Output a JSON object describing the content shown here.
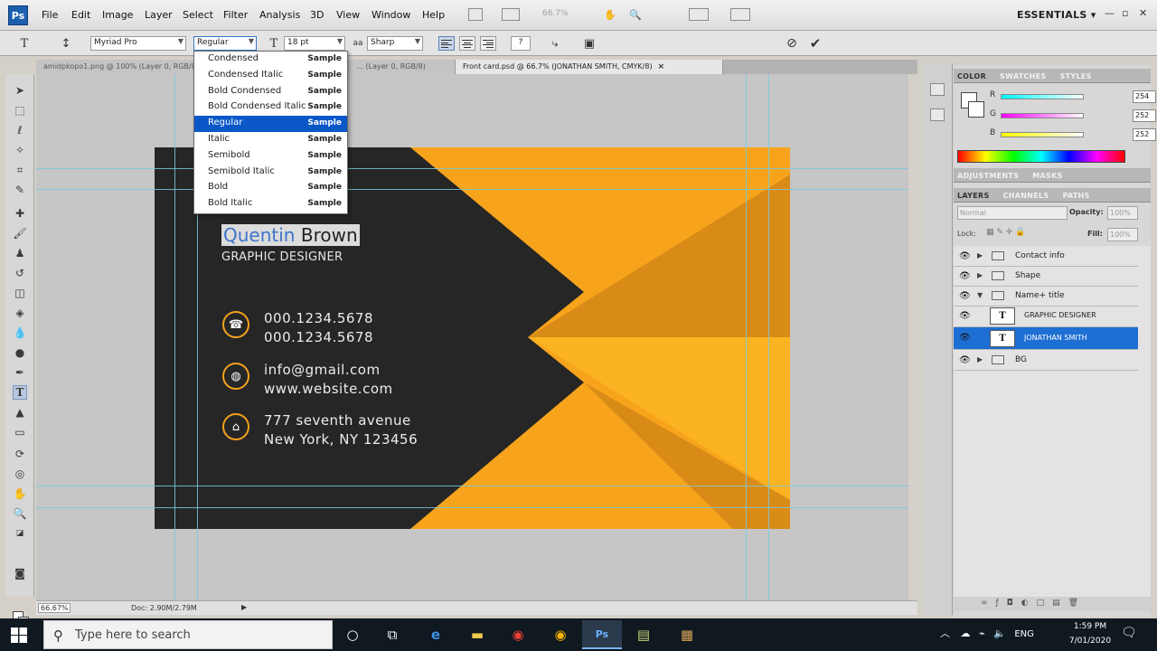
{
  "app": {
    "logo": "Ps",
    "workspace": "ESSENTIALS ▾"
  },
  "menu": [
    "File",
    "Edit",
    "Image",
    "Layer",
    "Select",
    "Filter",
    "Analysis",
    "3D",
    "View",
    "Window",
    "Help"
  ],
  "menubar_dim": "66.7%",
  "options": {
    "font_family": "Myriad Pro",
    "font_style": "Regular",
    "font_size": "18 pt",
    "antialias_label": "aa",
    "antialias": "Sharp"
  },
  "tabs": [
    {
      "label": "amidpkopo1.png @ 100% (Layer 0, RGB/8)",
      "active": false
    },
    {
      "label": "… (Layer 0, RGB/8)",
      "active": false
    },
    {
      "label": "Front card.psd @ 66.7% (JONATHAN SMITH, CMYK/8)",
      "active": true,
      "close": "×"
    }
  ],
  "font_styles": [
    {
      "name": "Condensed",
      "sample": "Sample"
    },
    {
      "name": "Condensed Italic",
      "sample": "Sample"
    },
    {
      "name": "Bold Condensed",
      "sample": "Sample"
    },
    {
      "name": "Bold Condensed Italic",
      "sample": "Sample"
    },
    {
      "name": "Regular",
      "sample": "Sample",
      "selected": true
    },
    {
      "name": "Italic",
      "sample": "Sample"
    },
    {
      "name": "Semibold",
      "sample": "Sample"
    },
    {
      "name": "Semibold Italic",
      "sample": "Sample"
    },
    {
      "name": "Bold",
      "sample": "Sample"
    },
    {
      "name": "Bold Italic",
      "sample": "Sample"
    }
  ],
  "card": {
    "first_name": "Quentin",
    "last_name": "Brown",
    "job_title": "GRAPHIC DESIGNER",
    "phone1": "000.1234.5678",
    "phone2": "000.1234.5678",
    "email": "info@gmail.com",
    "website": "www.website.com",
    "address1": "777 seventh avenue",
    "address2": "New York, NY 123456",
    "colors": {
      "dark": "#262626",
      "orange": "#f7a41c",
      "orange_light": "#fbb321",
      "orange_dark": "#d98b17"
    }
  },
  "status": {
    "zoom": "66.67%",
    "doc": "Doc: 2.90M/2.79M"
  },
  "color_panel": {
    "tabs": [
      "COLOR",
      "SWATCHES",
      "STYLES"
    ],
    "channels": [
      {
        "label": "R",
        "value": "254"
      },
      {
        "label": "G",
        "value": "252"
      },
      {
        "label": "B",
        "value": "252"
      }
    ]
  },
  "adjust_tabs": [
    "ADJUSTMENTS",
    "MASKS"
  ],
  "layers_panel": {
    "tabs": [
      "LAYERS",
      "CHANNELS",
      "PATHS"
    ],
    "blend_mode": "Normal",
    "opacity_label": "Opacity:",
    "opacity": "100%",
    "lock_label": "Lock:",
    "fill_label": "Fill:",
    "fill": "100%",
    "layers": [
      {
        "name": "Contact info",
        "type": "group",
        "expanded": false
      },
      {
        "name": "Shape",
        "type": "group",
        "expanded": false
      },
      {
        "name": "Name+ title",
        "type": "group",
        "expanded": true
      },
      {
        "name": "GRAPHIC DESIGNER",
        "type": "text",
        "thumb": "T",
        "selected": false
      },
      {
        "name": "JONATHAN SMITH",
        "type": "text",
        "thumb": "T",
        "selected": true
      },
      {
        "name": "BG",
        "type": "group",
        "expanded": false
      }
    ]
  },
  "taskbar": {
    "search_placeholder": "Type here to search",
    "tray_lang": "ENG",
    "time": "1:59 PM",
    "date": "7/01/2020"
  }
}
